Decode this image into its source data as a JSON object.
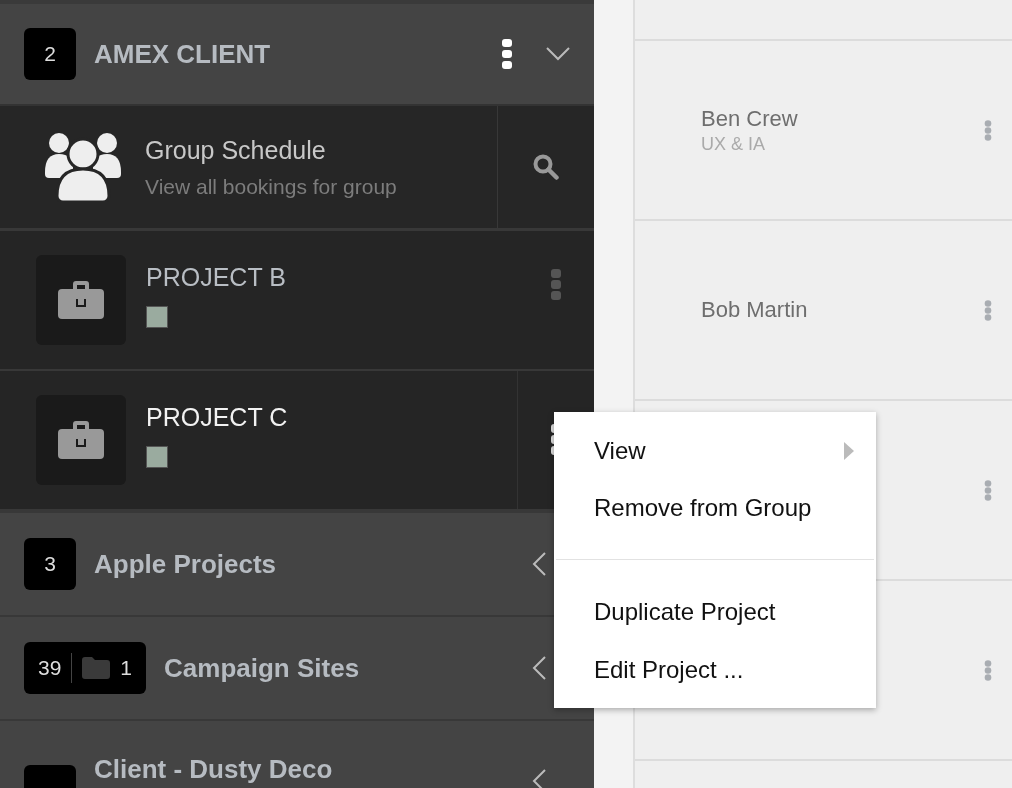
{
  "sidebar": {
    "groups": [
      {
        "badge": "2",
        "title": "AMEX CLIENT",
        "expanded": true,
        "has_menu": true,
        "schedule": {
          "title": "Group Schedule",
          "subtitle": "View all bookings for group"
        },
        "projects": [
          {
            "name": "PROJECT B",
            "color": "#9aab9f",
            "selected": false
          },
          {
            "name": "PROJECT C",
            "color": "#9aab9f",
            "selected": true
          }
        ]
      },
      {
        "badge": "3",
        "title": "Apple Projects",
        "expanded": false,
        "has_menu": false
      },
      {
        "badge": "39",
        "folders": "1",
        "title": "Campaign Sites",
        "expanded": false,
        "has_menu": false
      },
      {
        "title": "Client - Dusty Deco",
        "expanded": false,
        "has_menu": false
      }
    ]
  },
  "people": [
    {
      "name": "Ben Crew",
      "role": "UX & IA",
      "has_menu": true
    },
    {
      "name": "Bob Martin",
      "has_menu": true
    },
    {
      "has_menu": true
    },
    {
      "has_menu": true
    }
  ],
  "context_menu": {
    "items": [
      {
        "label": "View",
        "kind": "submenu"
      },
      {
        "label": "Remove from Group",
        "kind": "action"
      },
      {
        "kind": "separator"
      },
      {
        "label": "Duplicate Project",
        "kind": "action"
      },
      {
        "label": "Edit Project ...",
        "kind": "action"
      }
    ]
  }
}
